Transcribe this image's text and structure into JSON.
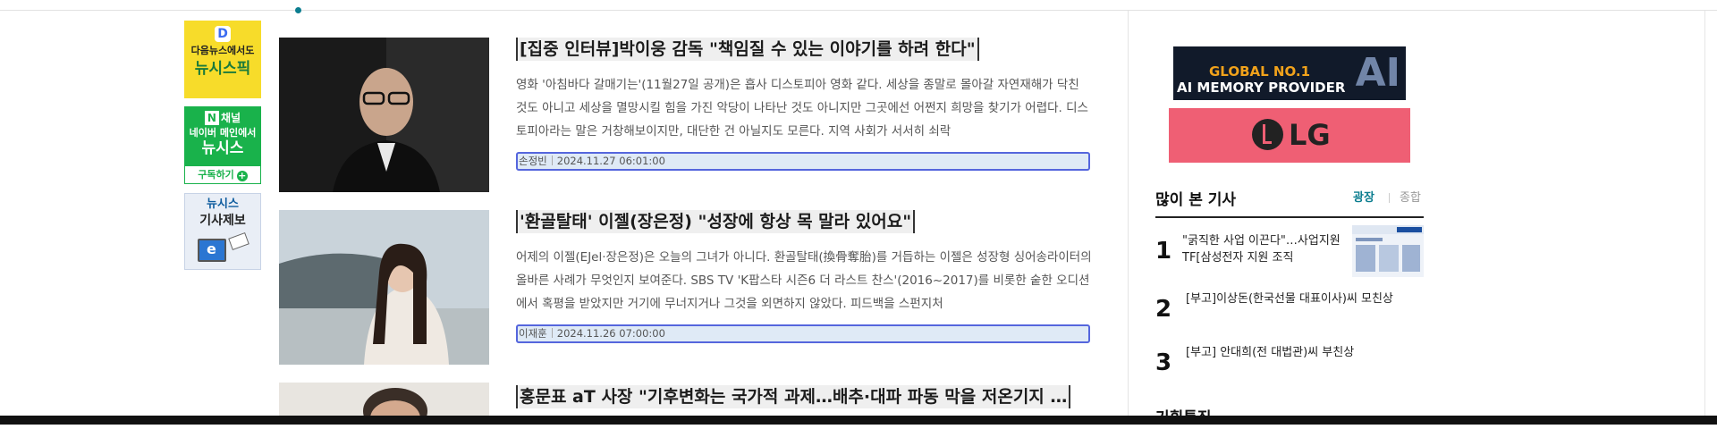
{
  "left_banners": {
    "daum": {
      "line1": "다음뉴스에서도",
      "line2": "뉴시스픽",
      "logo_letter": "D"
    },
    "naver": {
      "channel": "채널",
      "n": "N",
      "line1": "네이버 메인에서",
      "line2": "뉴시스",
      "subscribe": "구독하기",
      "plus": "+"
    },
    "report": {
      "line1": "뉴시스",
      "line2": "기사제보"
    }
  },
  "articles": [
    {
      "title": "[집중 인터뷰]박이웅 감독 \"책임질 수 있는 이야기를 하려 한다\"",
      "body": "영화 '아침바다 갈매기는'(11월27일 공개)은 흡사 디스토피아 영화 같다. 세상을 종말로 몰아갈 자연재해가 닥친 것도 아니고 세상을 멸망시킬 힘을 가진 악당이 나타난 것도 아니지만 그곳에선 어쩐지 희망을 찾기가 어렵다. 디스토피아라는 말은 거창해보이지만, 대단한 건 아닐지도 모른다. 지역 사회가 서서히 쇠락",
      "author": "손정빈",
      "date": "2024.11.27 06:01:00"
    },
    {
      "title": "'환골탈태' 이젤(장은정) \"성장에 항상 목 말라 있어요\"",
      "body": "어제의 이젤(EJel·장은정)은 오늘의 그녀가 아니다. 환골탈태(換骨奪胎)를 거듭하는 이젤은 성장형 싱어송라이터의 올바른 사례가 무엇인지 보여준다. SBS TV 'K팝스타 시즌6 더 라스트 찬스'(2016~2017)를 비롯한 숱한 오디션에서 혹평을 받았지만 거기에 무너지거나 그것을 외면하지 않았다. 피드백을 스펀지처",
      "author": "이재훈",
      "date": "2024.11.26 07:00:00"
    },
    {
      "title": "홍문표 aT 사장 \"기후변화는 국가적 과제…배추·대파 파동 막을 저온기지 …"
    }
  ],
  "ads": {
    "global": {
      "line1": "GLOBAL NO.1",
      "line2": "AI MEMORY PROVIDER",
      "mark": "AI"
    },
    "lg": {
      "text": "LG"
    }
  },
  "popular": {
    "title": "많이 본 기사",
    "tabs": [
      "광장",
      "종합"
    ],
    "items": [
      {
        "rank": "1",
        "title": "\"굵직한 사업 이끈다\"…사업지원TF[삼성전자 지원 조직"
      },
      {
        "rank": "2",
        "title": "[부고]이상돈(한국선물 대표이사)씨 모친상"
      },
      {
        "rank": "3",
        "title": "[부고] 안대희(전 대법관)씨 부친상"
      }
    ]
  },
  "next_section": {
    "title": "기획특집"
  },
  "colors": {
    "accent": "#0b7d8f",
    "meta_border": "#5566dd",
    "meta_bg": "#dfeaf6",
    "lg_pink": "#ef5f74"
  }
}
